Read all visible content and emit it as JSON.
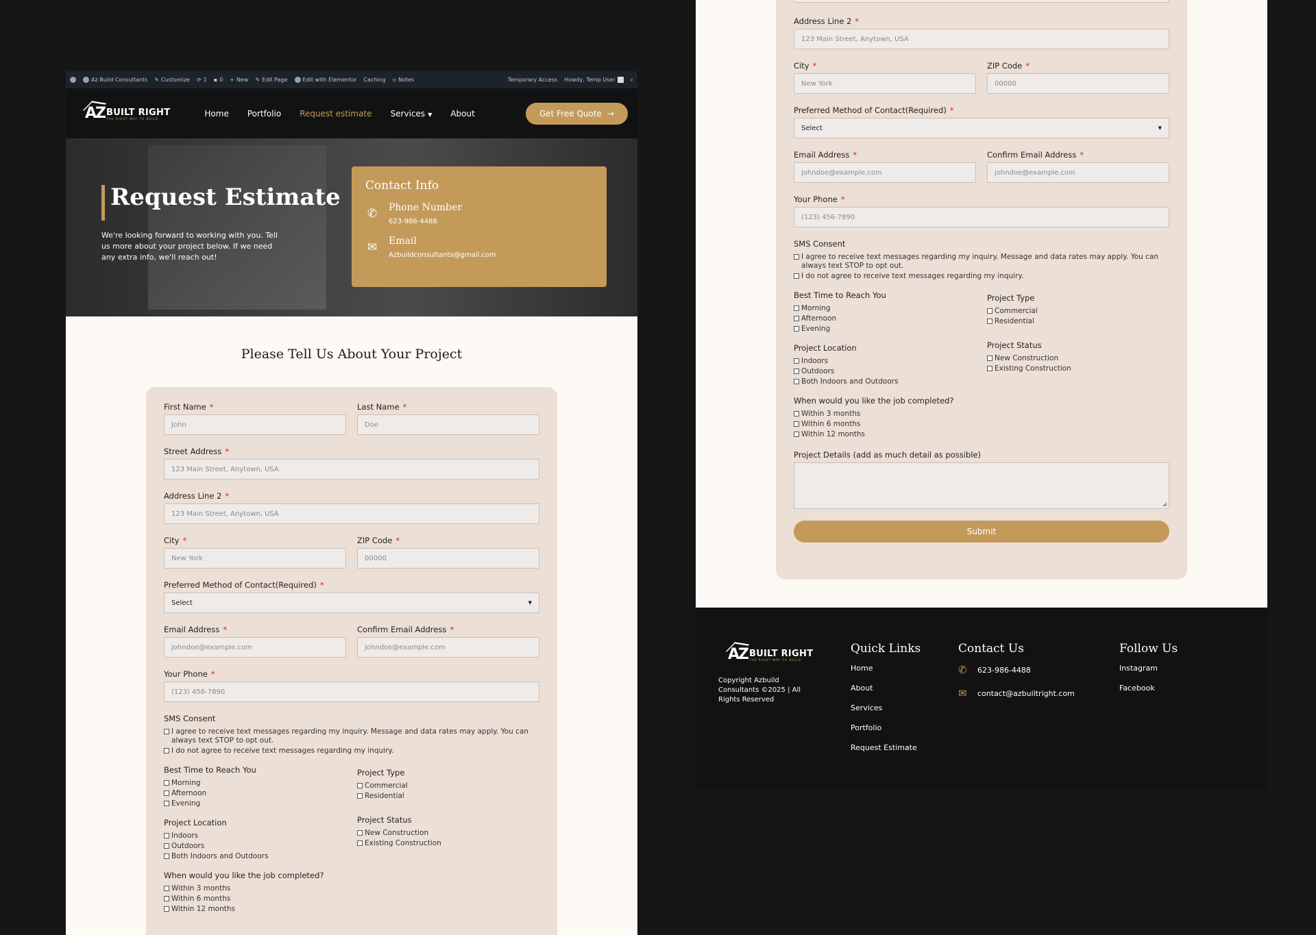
{
  "adminbar": {
    "site": "Az Build Consultants",
    "customize": "Customize",
    "updates": "1",
    "comments": "0",
    "new": "New",
    "edit_page": "Edit Page",
    "elementor": "Edit with Elementor",
    "caching": "Caching",
    "notes": "Notes",
    "temp": "Temporary Access",
    "howdy": "Howdy, Temp User"
  },
  "brand": {
    "mark": "AZ",
    "name": "BUILT RIGHT",
    "tagline": "THE RIGHT WAY TO BUILD",
    "accent": "#c49a5b",
    "dark": "#121212",
    "form_bg": "#ecdfd6"
  },
  "nav": {
    "home": "Home",
    "portfolio": "Portfolio",
    "request": "Request estimate",
    "services": "Services",
    "about": "About",
    "cta": "Get Free Quote"
  },
  "hero": {
    "title": "Request Estimate",
    "text": "We're looking forward to working with you. Tell us more about your project below. If we need any extra info, we'll reach out!",
    "contact_title": "Contact Info",
    "phone_label": "Phone Number",
    "phone": "623-986-4488",
    "email_label": "Email",
    "email": "Azbuildconsultants@gmail.com"
  },
  "form": {
    "title": "Please Tell Us About Your Project",
    "req": "*",
    "first_name": {
      "label": "First Name",
      "placeholder": "John"
    },
    "last_name": {
      "label": "Last Name",
      "placeholder": "Doe"
    },
    "street": {
      "label": "Street Address",
      "placeholder": "123 Main Street, Anytown, USA"
    },
    "address2": {
      "label": "Address Line 2",
      "placeholder": "123 Main Street, Anytown, USA"
    },
    "city": {
      "label": "City",
      "placeholder": "New York"
    },
    "zip": {
      "label": "ZIP Code",
      "placeholder": "00000"
    },
    "contact_method": {
      "label": "Preferred Method of Contact(Required)",
      "value": "Select"
    },
    "email": {
      "label": "Email Address",
      "placeholder": "johndoe@example.com"
    },
    "confirm_email": {
      "label": "Confirm Email Address",
      "placeholder": "johndoe@example.com"
    },
    "phone": {
      "label": "Your Phone",
      "placeholder": "(123) 456-7890"
    },
    "sms": {
      "label": "SMS Consent",
      "agree": "I agree to receive text messages regarding my inquiry. Message and data rates may apply. You can always text STOP to opt out.",
      "disagree": "I do not agree to receive text messages regarding my inquiry."
    },
    "best_time": {
      "label": "Best Time to Reach You",
      "options": [
        "Morning",
        "Afternoon",
        "Evening"
      ]
    },
    "project_type": {
      "label": "Project Type",
      "options": [
        "Commercial",
        "Residential"
      ]
    },
    "location": {
      "label": "Project Location",
      "options": [
        "Indoors",
        "Outdoors",
        "Both Indoors and Outdoors"
      ]
    },
    "status": {
      "label": "Project Status",
      "options": [
        "New Construction",
        "Existing Construction"
      ]
    },
    "timeline": {
      "label": "When would you like the job completed?",
      "options": [
        "Within 3 months",
        "Within 6 months",
        "Within 12 months"
      ]
    },
    "details": {
      "label": "Project Details (add as much detail as possible)"
    },
    "submit": "Submit"
  },
  "footer": {
    "copyright": "Copyright Azbuild Consultants ©2025 | All Rights Reserved",
    "quick_title": "Quick Links",
    "links": [
      "Home",
      "About",
      "Services",
      "Portfolio",
      "Request Estimate"
    ],
    "contact_title": "Contact Us",
    "phone": "623-986-4488",
    "email": "contact@azbuiltright.com",
    "follow_title": "Follow Us",
    "social": [
      "Instagram",
      "Facebook"
    ]
  }
}
